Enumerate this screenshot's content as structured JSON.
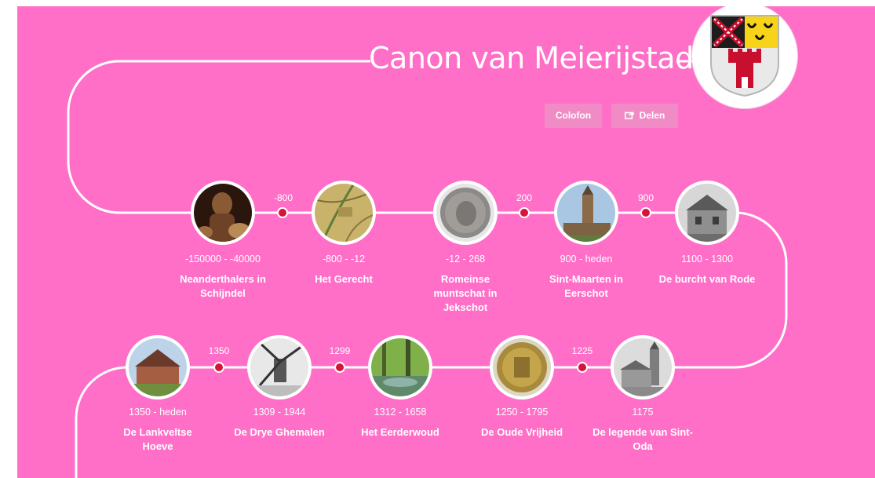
{
  "title": "Canon van Meierijstad",
  "buttons": {
    "colofon": "Colofon",
    "delen": "Delen"
  },
  "icons": {
    "crest": "municipal-coat-of-arms",
    "share": "share-icon"
  },
  "colors": {
    "background": "#ff6ec7",
    "accent_dot": "#d4143a",
    "button": "#f08bc6"
  },
  "row1": [
    {
      "date": "-150000 - -40000",
      "name": "Neanderthalers in Schijndel"
    },
    {
      "date": "-800 - -12",
      "name": "Het Gerecht"
    },
    {
      "date": "-12 - 268",
      "name": "Romeinse muntschat in Jekschot"
    },
    {
      "date": "900 - heden",
      "name": "Sint-Maarten in Eerschot"
    },
    {
      "date": "1100 - 1300",
      "name": "De burcht van Rode"
    }
  ],
  "row1_markers": [
    "-800",
    "200",
    "900"
  ],
  "row2": [
    {
      "date": "1350 - heden",
      "name": "De Lankveltse Hoeve"
    },
    {
      "date": "1309 - 1944",
      "name": "De Drye Ghemalen"
    },
    {
      "date": "1312 - 1658",
      "name": "Het Eerderwoud"
    },
    {
      "date": "1250 - 1795",
      "name": "De Oude Vrijheid"
    },
    {
      "date": "1175",
      "name": "De legende van Sint-Oda"
    }
  ],
  "row2_markers": [
    "1350",
    "1299",
    "1225"
  ]
}
